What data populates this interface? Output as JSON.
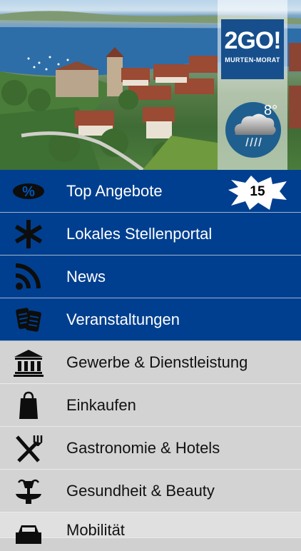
{
  "header": {
    "logo_main": "2GO!",
    "logo_sub": "MURTEN-MORAT",
    "weather": {
      "icon": "rain-cloud-icon",
      "temperature": "8°"
    }
  },
  "menu": [
    {
      "label": "Top Angebote",
      "icon": "percent-icon",
      "badge": "15",
      "style": "blue"
    },
    {
      "label": "Lokales Stellenportal",
      "icon": "asterisk-icon",
      "style": "blue"
    },
    {
      "label": "News",
      "icon": "rss-icon",
      "style": "blue"
    },
    {
      "label": "Veranstaltungen",
      "icon": "tickets-icon",
      "style": "blue"
    },
    {
      "label": "Gewerbe & Dienstleistung",
      "icon": "bank-icon",
      "style": "grey"
    },
    {
      "label": "Einkaufen",
      "icon": "shopping-bag-icon",
      "style": "grey"
    },
    {
      "label": "Gastronomie & Hotels",
      "icon": "fork-knife-icon",
      "style": "grey"
    },
    {
      "label": "Gesundheit & Beauty",
      "icon": "fountain-icon",
      "style": "grey"
    },
    {
      "label": "Mobilität",
      "icon": "car-icon",
      "style": "grey"
    }
  ]
}
